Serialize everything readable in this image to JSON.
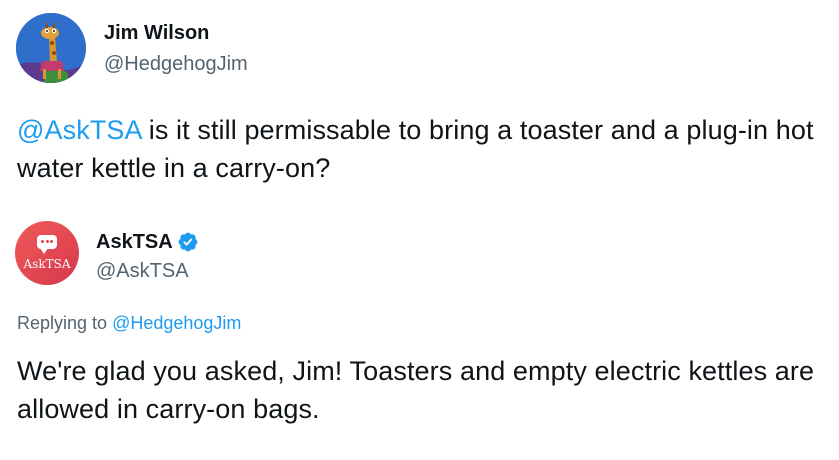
{
  "tweet1": {
    "author_name": "Jim Wilson",
    "author_handle": "@HedgehogJim",
    "mention": "@AskTSA",
    "text_after_mention": " is it still permissable to bring a toaster and a plug-in hot water kettle in a carry-on?",
    "avatar_icon": "giraffe-avatar-icon"
  },
  "tweet2": {
    "author_name": "AskTSA",
    "author_handle": "@AskTSA",
    "verified_icon": "verified-badge-icon",
    "avatar_logo_text": "AskTSA",
    "replying_prefix": "Replying to ",
    "replying_to": "@HedgehogJim",
    "text": "We're glad you asked, Jim! Toasters and empty electric kettles are allowed in carry-on bags."
  },
  "colors": {
    "link_blue": "#1d9bf0",
    "muted_gray": "#536471",
    "text_dark": "#0f1419",
    "tsa_red": "#e04552"
  }
}
